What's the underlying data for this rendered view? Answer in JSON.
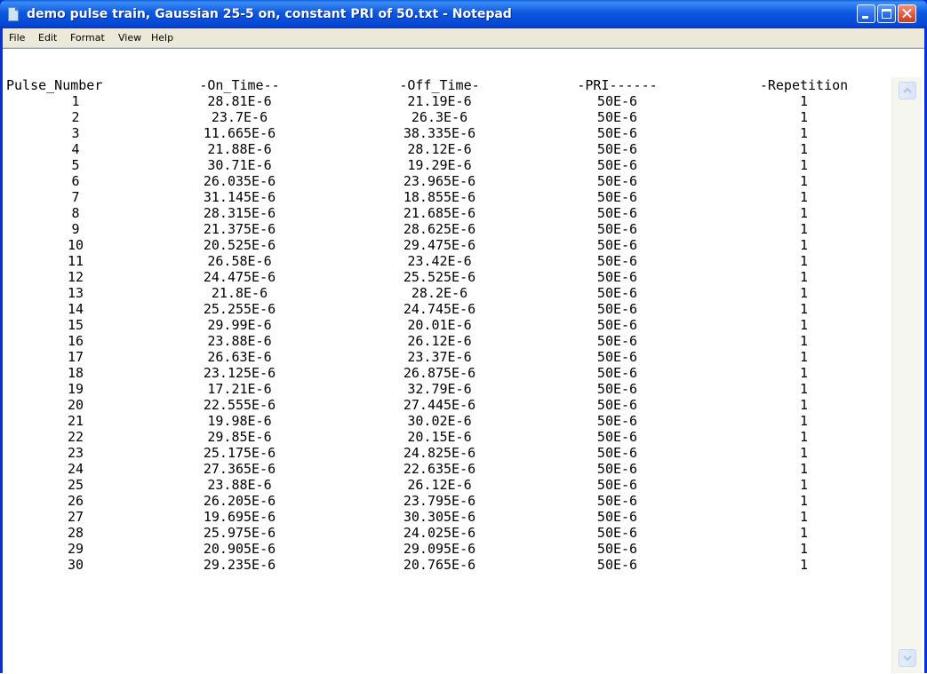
{
  "window": {
    "title": "demo pulse train, Gaussian 25-5 on, constant PRI of 50.txt - Notepad"
  },
  "menu": {
    "file": "File",
    "edit": "Edit",
    "format": "Format",
    "view": "View",
    "help": "Help"
  },
  "table": {
    "headers": [
      "Pulse_Number",
      "-On_Time--",
      "-Off_Time-",
      "-PRI------",
      "-Repetition"
    ],
    "rows": [
      [
        "1",
        "28.81E-6",
        "21.19E-6",
        "50E-6",
        "1"
      ],
      [
        "2",
        "23.7E-6",
        "26.3E-6",
        "50E-6",
        "1"
      ],
      [
        "3",
        "11.665E-6",
        "38.335E-6",
        "50E-6",
        "1"
      ],
      [
        "4",
        "21.88E-6",
        "28.12E-6",
        "50E-6",
        "1"
      ],
      [
        "5",
        "30.71E-6",
        "19.29E-6",
        "50E-6",
        "1"
      ],
      [
        "6",
        "26.035E-6",
        "23.965E-6",
        "50E-6",
        "1"
      ],
      [
        "7",
        "31.145E-6",
        "18.855E-6",
        "50E-6",
        "1"
      ],
      [
        "8",
        "28.315E-6",
        "21.685E-6",
        "50E-6",
        "1"
      ],
      [
        "9",
        "21.375E-6",
        "28.625E-6",
        "50E-6",
        "1"
      ],
      [
        "10",
        "20.525E-6",
        "29.475E-6",
        "50E-6",
        "1"
      ],
      [
        "11",
        "26.58E-6",
        "23.42E-6",
        "50E-6",
        "1"
      ],
      [
        "12",
        "24.475E-6",
        "25.525E-6",
        "50E-6",
        "1"
      ],
      [
        "13",
        "21.8E-6",
        "28.2E-6",
        "50E-6",
        "1"
      ],
      [
        "14",
        "25.255E-6",
        "24.745E-6",
        "50E-6",
        "1"
      ],
      [
        "15",
        "29.99E-6",
        "20.01E-6",
        "50E-6",
        "1"
      ],
      [
        "16",
        "23.88E-6",
        "26.12E-6",
        "50E-6",
        "1"
      ],
      [
        "17",
        "26.63E-6",
        "23.37E-6",
        "50E-6",
        "1"
      ],
      [
        "18",
        "23.125E-6",
        "26.875E-6",
        "50E-6",
        "1"
      ],
      [
        "19",
        "17.21E-6",
        "32.79E-6",
        "50E-6",
        "1"
      ],
      [
        "20",
        "22.555E-6",
        "27.445E-6",
        "50E-6",
        "1"
      ],
      [
        "21",
        "19.98E-6",
        "30.02E-6",
        "50E-6",
        "1"
      ],
      [
        "22",
        "29.85E-6",
        "20.15E-6",
        "50E-6",
        "1"
      ],
      [
        "23",
        "25.175E-6",
        "24.825E-6",
        "50E-6",
        "1"
      ],
      [
        "24",
        "27.365E-6",
        "22.635E-6",
        "50E-6",
        "1"
      ],
      [
        "25",
        "23.88E-6",
        "26.12E-6",
        "50E-6",
        "1"
      ],
      [
        "26",
        "26.205E-6",
        "23.795E-6",
        "50E-6",
        "1"
      ],
      [
        "27",
        "19.695E-6",
        "30.305E-6",
        "50E-6",
        "1"
      ],
      [
        "28",
        "25.975E-6",
        "24.025E-6",
        "50E-6",
        "1"
      ],
      [
        "29",
        "20.905E-6",
        "29.095E-6",
        "50E-6",
        "1"
      ],
      [
        "30",
        "29.235E-6",
        "20.765E-6",
        "50E-6",
        "1"
      ]
    ]
  },
  "icons": {
    "app": "notepad-icon",
    "minimize": "minimize-icon",
    "maximize": "maximize-icon",
    "close": "close-icon",
    "scroll_up": "scroll-up-arrow-icon",
    "scroll_down": "scroll-down-arrow-icon"
  },
  "colors": {
    "titlebar": "#0b58e0",
    "close_button": "#e05a40",
    "menubar": "#ece9d8",
    "editor_background": "#ffffff",
    "text": "#000000"
  }
}
